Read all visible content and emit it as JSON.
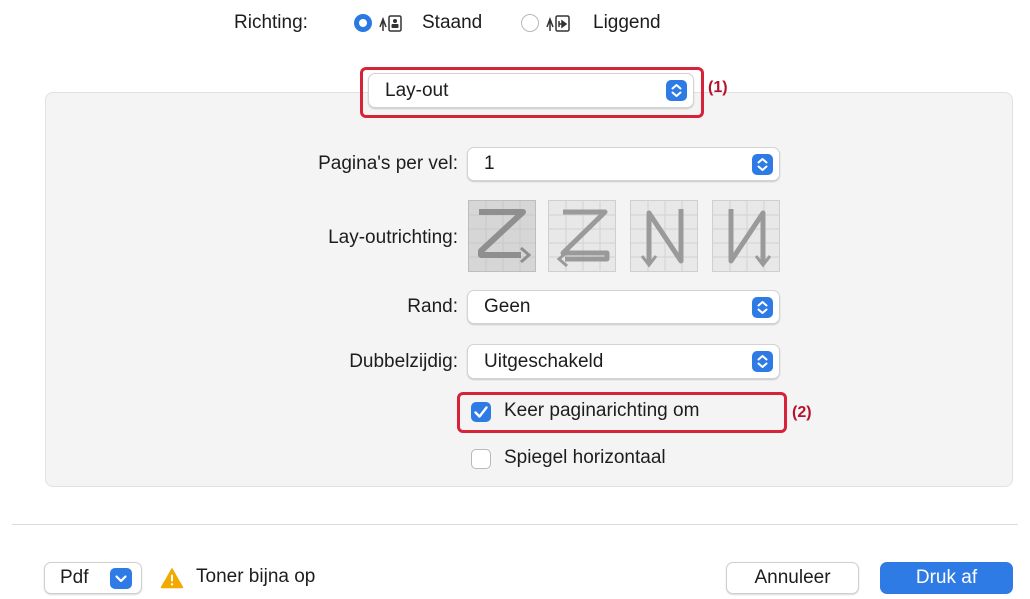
{
  "orientation": {
    "label": "Richting:",
    "portrait_label": "Staand",
    "landscape_label": "Liggend",
    "selected": "Staand"
  },
  "section_popup": {
    "value": "Lay-out",
    "callout": "(1)"
  },
  "layout": {
    "pages_per_sheet": {
      "label": "Pagina's per vel:",
      "value": "1"
    },
    "layout_direction": {
      "label": "Lay-outrichting:",
      "selected_index": 0
    },
    "border": {
      "label": "Rand:",
      "value": "Geen"
    },
    "duplex": {
      "label": "Dubbelzijdig:",
      "value": "Uitgeschakeld"
    },
    "reverse_orientation": {
      "label": "Keer paginarichting om",
      "checked": true,
      "callout": "(2)"
    },
    "flip_horizontal": {
      "label": "Spiegel horizontaal",
      "checked": false
    }
  },
  "footer": {
    "pdf_label": "Pdf",
    "warning_text": "Toner bijna op",
    "cancel_label": "Annuleer",
    "print_label": "Druk af"
  },
  "colors": {
    "accent": "#2f7be5",
    "annotation": "#d6233a",
    "warning": "#f2a900"
  },
  "icons": [
    "radio-icon",
    "portrait-orientation-icon",
    "landscape-orientation-icon",
    "popup-arrows-icon",
    "layout-z-icon",
    "layout-reverse-z-icon",
    "layout-reverse-n-icon",
    "layout-n-icon",
    "checkmark-icon",
    "warning-icon",
    "chevron-down-icon"
  ]
}
